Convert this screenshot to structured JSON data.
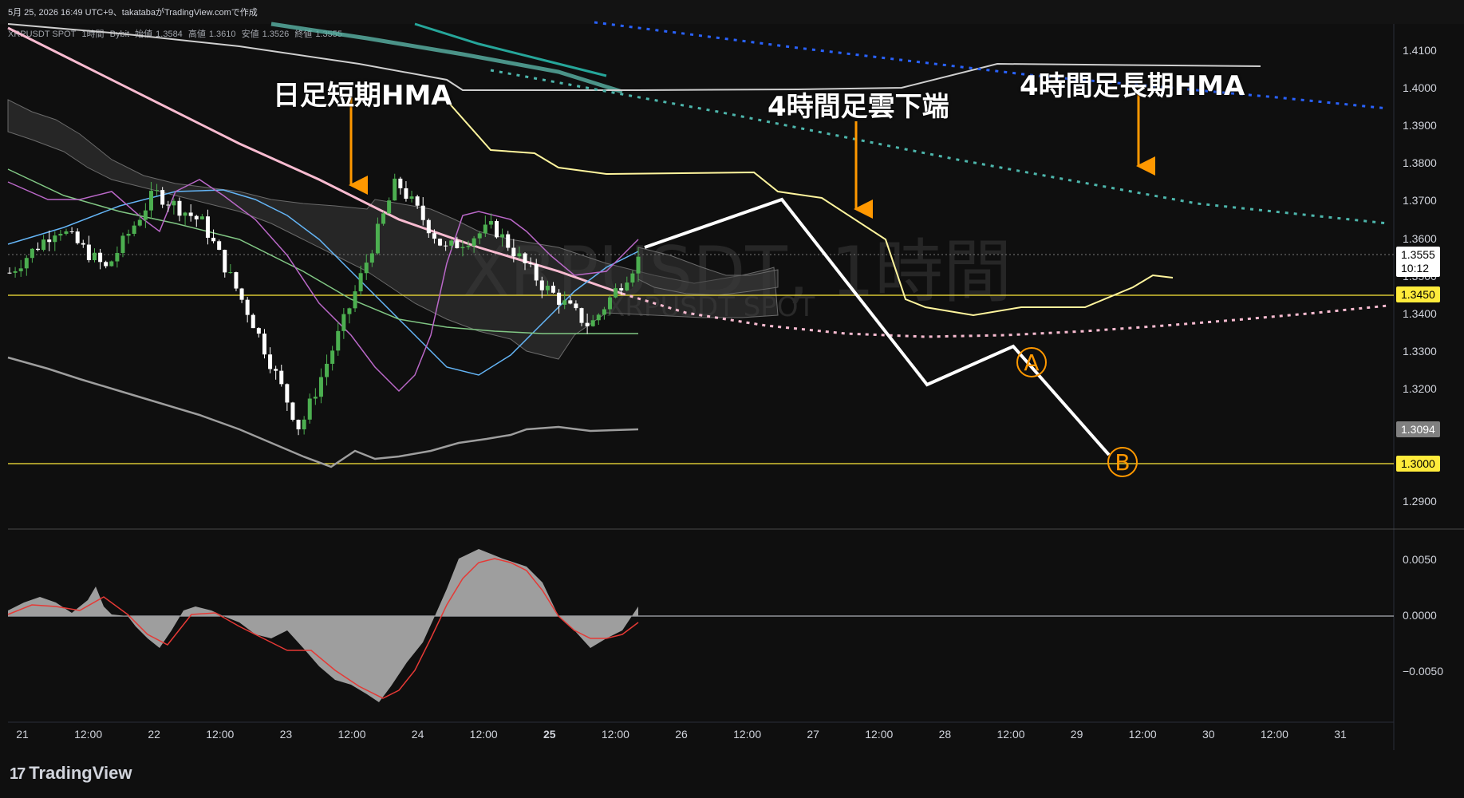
{
  "header": {
    "created_line": "5月 25, 2026 16:49 UTC+9、takatabaがTradingView.comで作成",
    "symbol": "XRPUSDT SPOT",
    "interval": "1時間",
    "exchange": "Bybit",
    "ohlc": [
      {
        "label": "始値",
        "value": "1.3584"
      },
      {
        "label": "高値",
        "value": "1.3610"
      },
      {
        "label": "安値",
        "value": "1.3526"
      },
      {
        "label": "終値",
        "value": "1.3555"
      }
    ]
  },
  "watermark": {
    "main": "XRPUSDT, 1時間",
    "sub": "XRPUSDT SPOT"
  },
  "annotations": {
    "daily_short_hma": "日足短期HMA",
    "h4_cloud_bottom": "4時間足雲下端",
    "h4_long_hma": "4時間足長期HMA",
    "wave_a": "A",
    "wave_b": "B"
  },
  "price_labels": {
    "current": "1.3555",
    "countdown": "10:12",
    "level_1": "1.3450",
    "level_gray": "1.3094",
    "level_2": "1.3000"
  },
  "brand": {
    "name": "TradingView"
  },
  "colors": {
    "bg": "#0f0f0f",
    "up": "#26a69a",
    "up_candle": "#4caf50",
    "down": "#ffffff",
    "level_yellow": "#ffeb3b",
    "pink_hma": "#f8bbd0",
    "teal_dotted": "#26a69a",
    "blue_dotted": "#2962ff",
    "cloud_line": "#fff59d",
    "annotation_arrow": "#ff9800"
  },
  "chart_data": [
    {
      "type": "line",
      "title": "XRPUSDT, 1時間",
      "ylim": [
        1.285,
        1.413
      ],
      "yticks": [
        "1.4100",
        "1.4000",
        "1.3900",
        "1.3800",
        "1.3700",
        "1.3600",
        "1.3500",
        "1.3400",
        "1.3300",
        "1.3200",
        "1.3100",
        "1.3000",
        "1.2900"
      ],
      "xticks": [
        "21",
        "12:00",
        "22",
        "12:00",
        "23",
        "12:00",
        "24",
        "12:00",
        "25",
        "12:00",
        "26",
        "12:00",
        "27",
        "12:00",
        "28",
        "12:00",
        "29",
        "12:00",
        "30",
        "12:00",
        "31"
      ],
      "horizontal_levels": [
        1.345,
        1.3
      ],
      "price_path": [
        {
          "x": "21 00:00",
          "y": 1.352
        },
        {
          "x": "21 12:00",
          "y": 1.364
        },
        {
          "x": "22 00:00",
          "y": 1.353
        },
        {
          "x": "22 06:00",
          "y": 1.373
        },
        {
          "x": "22 18:00",
          "y": 1.365
        },
        {
          "x": "23 06:00",
          "y": 1.34
        },
        {
          "x": "23 18:00",
          "y": 1.311
        },
        {
          "x": "24 06:00",
          "y": 1.342
        },
        {
          "x": "24 10:00",
          "y": 1.376
        },
        {
          "x": "24 16:00",
          "y": 1.358
        },
        {
          "x": "25 00:00",
          "y": 1.364
        },
        {
          "x": "25 06:00",
          "y": 1.349
        },
        {
          "x": "25 08:00",
          "y": 1.338
        },
        {
          "x": "25 14:00",
          "y": 1.3555
        }
      ],
      "scenario_path": [
        {
          "x": "25 14:00",
          "y": 1.3555
        },
        {
          "x": "26 20:00",
          "y": 1.37
        },
        {
          "x": "28 02:00",
          "y": 1.321
        },
        {
          "x": "28 14:00",
          "y": 1.331,
          "label": "A"
        },
        {
          "x": "29 08:00",
          "y": 1.3,
          "label": "B"
        }
      ]
    },
    {
      "type": "area",
      "title": "",
      "ylim": [
        -0.0085,
        0.0065
      ],
      "yticks": [
        "0.0050",
        "0.0000",
        "−0.0050"
      ]
    }
  ]
}
